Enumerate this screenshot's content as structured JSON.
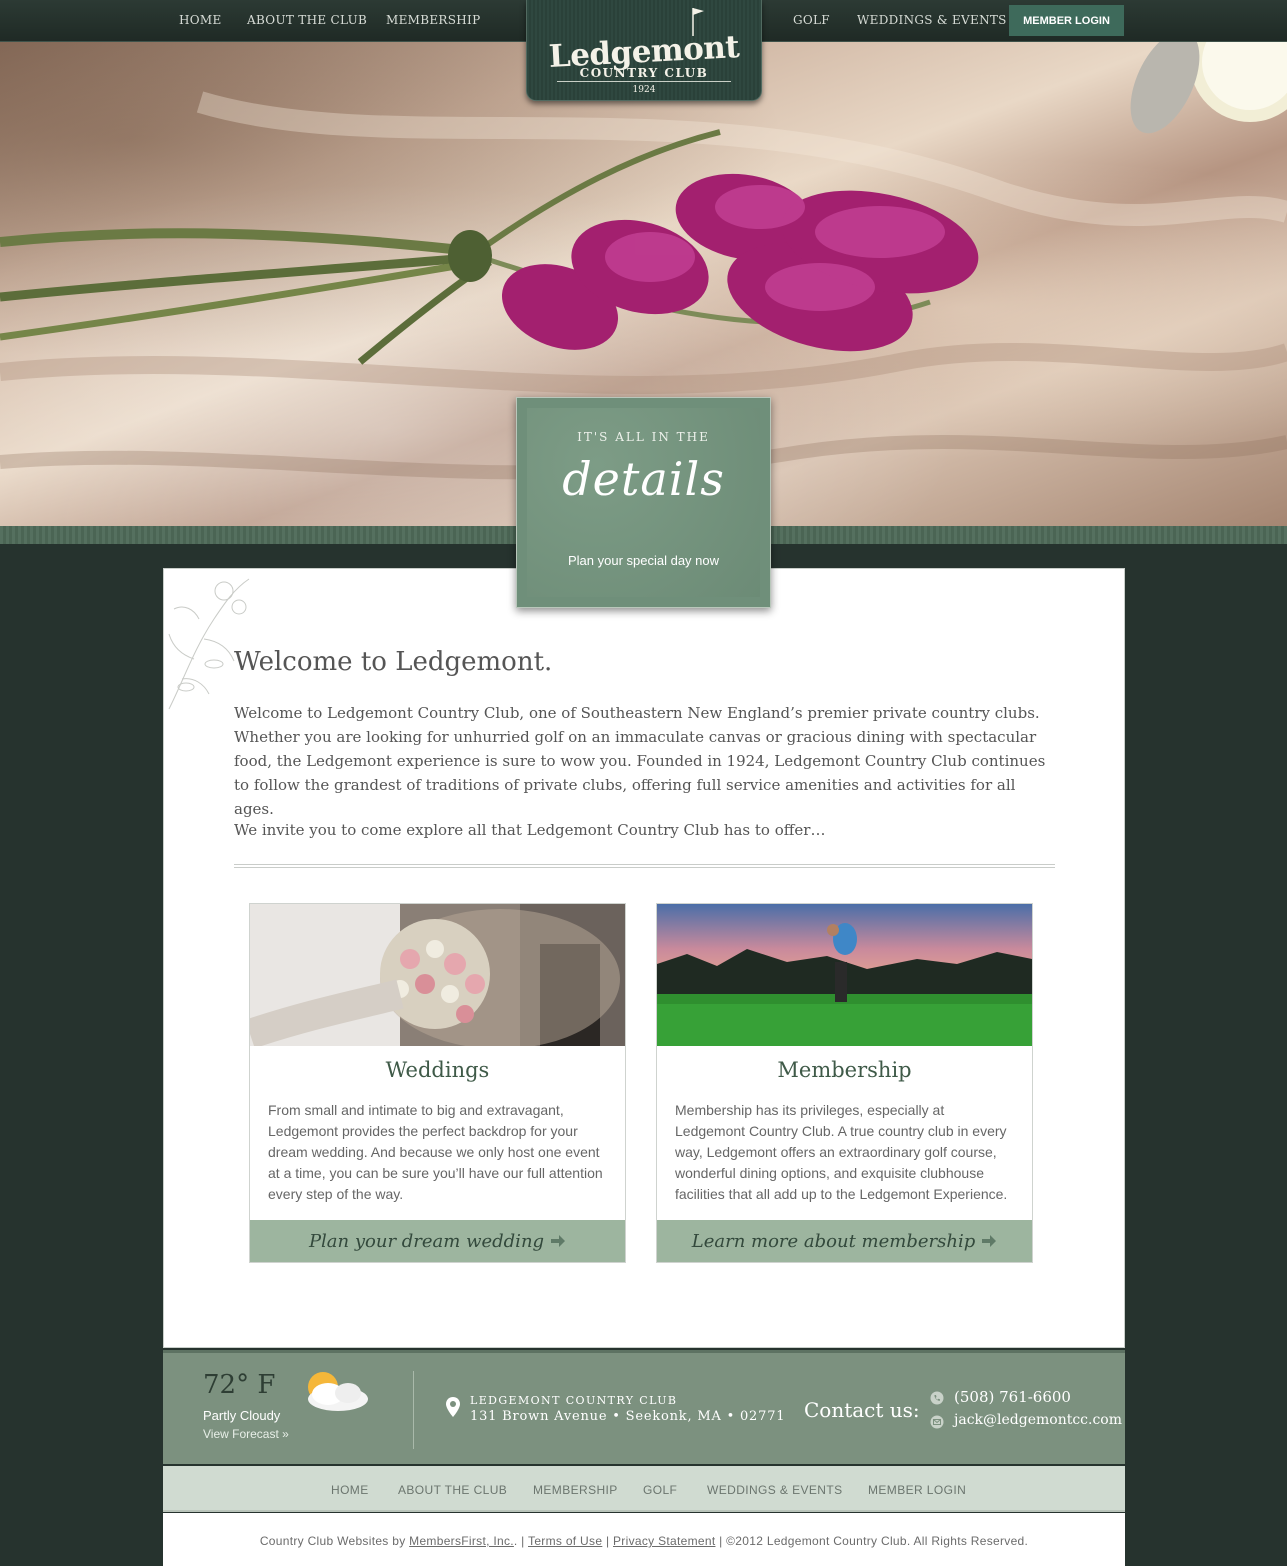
{
  "nav": {
    "home": "HOME",
    "about": "ABOUT THE CLUB",
    "membership": "MEMBERSHIP",
    "golf": "GOLF",
    "weddings": "WEDDINGS & EVENTS",
    "member_login": "MEMBER LOGIN"
  },
  "logo": {
    "name": "Ledgemont",
    "subtitle": "COUNTRY CLUB",
    "year": "1924"
  },
  "hero": {
    "kicker": "IT'S ALL IN THE",
    "script": "details",
    "cta": "Plan your special day now"
  },
  "welcome": {
    "title": "Welcome to Ledgemont.",
    "body": "Welcome to Ledgemont Country Club, one of Southeastern New England’s premier private country clubs. Whether you are looking for unhurried golf on an immaculate canvas or gracious dining with spectacular food, the Ledgemont experience is sure to wow you. Founded in 1924, Ledgemont Country Club continues to follow the grandest of traditions of private clubs, offering full service amenities and activities for all ages.",
    "invite": "We invite you to come explore all that Ledgemont Country Club has to offer…"
  },
  "cards": [
    {
      "title": "Weddings",
      "text": "From small and intimate to big and extravagant, Ledgemont provides the perfect backdrop for your dream wedding. And because we only host one event at a time, you can be sure you’ll have our full attention every step of the way.",
      "button": "Plan your dream wedding"
    },
    {
      "title": "Membership",
      "text": "Membership has its privileges, especially at Ledgemont Country Club. A true country club in every way, Ledgemont offers an extraordinary golf course, wonderful dining options, and exquisite clubhouse facilities that all add up to the Ledgemont Experience.",
      "button": "Learn more about membership"
    }
  ],
  "weather": {
    "temp": "72° F",
    "condition": "Partly Cloudy",
    "forecast_link": "View Forecast »"
  },
  "address": {
    "name": "LEDGEMONT COUNTRY CLUB",
    "street": "131 Brown Avenue • Seekonk, MA • 02771"
  },
  "contact": {
    "label": "Contact us:",
    "phone": "(508) 761-6600",
    "email": "jack@ledgemontcc.com"
  },
  "footer_nav": {
    "home": "HOME",
    "about": "ABOUT THE CLUB",
    "membership": "MEMBERSHIP",
    "golf": "GOLF",
    "weddings": "WEDDINGS & EVENTS",
    "member_login": "MEMBER LOGIN"
  },
  "copyright": {
    "prefix": "Country Club Websites by ",
    "provider": "MembersFirst, Inc.",
    "sep1": ". | ",
    "terms": "Terms of Use",
    "sep2": " | ",
    "privacy": "Privacy Statement",
    "suffix": " | ©2012 Ledgemont Country Club. All Rights Reserved."
  },
  "colors": {
    "background": "#26332e",
    "accent_green": "#7c917f",
    "button_green": "#9db59f",
    "login_green": "#3e6a5b"
  }
}
